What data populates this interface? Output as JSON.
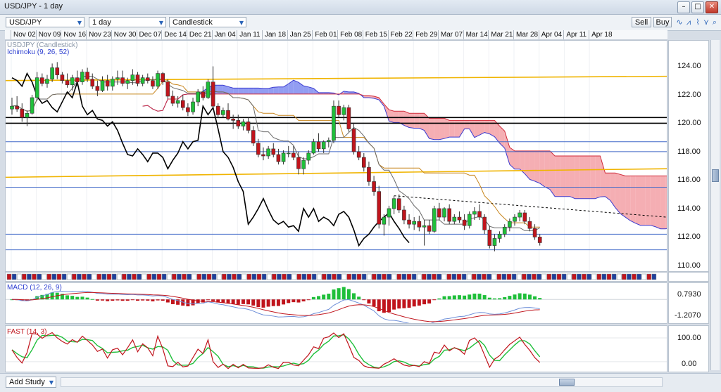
{
  "window": {
    "title": "USD/JPY - 1 day",
    "minimize_glyph": "–",
    "maximize_glyph": "□",
    "close_glyph": "✕"
  },
  "toolbar": {
    "instrument": "USD/JPY",
    "interval": "1 day",
    "chart_type": "Candlestick",
    "sell_label": "Sell",
    "buy_label": "Buy",
    "icons": [
      "line-draw-icon",
      "trend-icon",
      "crosshair-icon",
      "indicator-icon",
      "zoom-icon",
      "more-icon"
    ]
  },
  "date_labels": [
    "Nov 02",
    "Nov 09",
    "Nov 16",
    "Nov 23",
    "Nov 30",
    "Dec 07",
    "Dec 14",
    "Dec 21",
    "Jan 04",
    "Jan 11",
    "Jan 18",
    "Jan 25",
    "Feb 01",
    "Feb 08",
    "Feb 15",
    "Feb 22",
    "Feb 29",
    "Mar 07",
    "Mar 14",
    "Mar 21",
    "Mar 28",
    "Apr 04",
    "Apr 11",
    "Apr 18"
  ],
  "main_panel": {
    "label_symbol": "USDJPY (Candlestick)",
    "label_ichimoku": "Ichimoku (9, 26, 52)",
    "axis_ticks": [
      "124.00",
      "122.00",
      "120.00",
      "118.00",
      "116.00",
      "114.00",
      "112.00",
      "110.00"
    ]
  },
  "macd_panel": {
    "label": "MACD (12, 26, 9)",
    "axis_ticks": [
      "0.7930",
      "-1.2070"
    ]
  },
  "fast_panel": {
    "label": "FAST (14, 3)",
    "axis_ticks": [
      "100.00",
      "0.00"
    ]
  },
  "bottom": {
    "add_study": "Add Study"
  },
  "colors": {
    "bull": "#1fbf3a",
    "bear": "#c0141c",
    "cloud_blue": "#7f8cf0",
    "cloud_red": "#f3a0a6",
    "kijun": "#c8861e",
    "tenkan": "#6a6a6a",
    "chikou": "#000000",
    "hline_blue": "#4169c8",
    "hline_black": "#000000",
    "hline_orange": "#f0b400"
  },
  "chart_data": [
    {
      "type": "candlestick",
      "title": "USDJPY (Candlestick)",
      "ylim": [
        109.6,
        125.8
      ],
      "x_start": "Nov 02",
      "candles": [
        [
          121.0,
          121.8,
          120.6,
          121.2
        ],
        [
          121.2,
          121.9,
          120.8,
          121.0
        ],
        [
          121.0,
          121.4,
          120.1,
          120.4
        ],
        [
          120.4,
          120.9,
          119.8,
          120.7
        ],
        [
          120.7,
          122.0,
          120.6,
          121.8
        ],
        [
          121.8,
          123.6,
          121.6,
          123.2
        ],
        [
          123.2,
          123.5,
          122.6,
          122.8
        ],
        [
          122.8,
          123.4,
          122.5,
          123.1
        ],
        [
          123.1,
          124.2,
          122.9,
          123.9
        ],
        [
          123.9,
          124.3,
          123.1,
          123.4
        ],
        [
          123.4,
          123.6,
          122.8,
          123.0
        ],
        [
          123.0,
          123.5,
          122.5,
          122.7
        ],
        [
          122.7,
          123.4,
          122.3,
          123.2
        ],
        [
          123.2,
          123.7,
          122.6,
          122.9
        ],
        [
          122.9,
          123.8,
          122.7,
          123.6
        ],
        [
          123.6,
          123.9,
          122.9,
          123.1
        ],
        [
          123.1,
          123.5,
          122.4,
          122.6
        ],
        [
          122.6,
          123.0,
          121.9,
          122.3
        ],
        [
          122.3,
          123.3,
          122.2,
          123.0
        ],
        [
          123.0,
          123.4,
          122.3,
          122.6
        ],
        [
          122.6,
          123.3,
          122.3,
          123.1
        ],
        [
          123.1,
          123.7,
          122.7,
          123.2
        ],
        [
          123.2,
          123.7,
          122.6,
          122.8
        ],
        [
          122.8,
          123.2,
          122.4,
          123.0
        ],
        [
          123.0,
          123.8,
          122.7,
          123.4
        ],
        [
          123.4,
          123.6,
          122.6,
          122.8
        ],
        [
          122.8,
          123.4,
          122.6,
          123.2
        ],
        [
          123.2,
          123.5,
          122.8,
          123.0
        ],
        [
          123.0,
          123.3,
          122.4,
          122.6
        ],
        [
          122.6,
          123.7,
          122.4,
          123.5
        ],
        [
          123.5,
          123.6,
          122.7,
          122.9
        ],
        [
          122.9,
          123.1,
          121.7,
          121.9
        ],
        [
          121.9,
          122.3,
          121.2,
          121.4
        ],
        [
          121.4,
          121.9,
          121.1,
          121.6
        ],
        [
          121.6,
          122.0,
          120.9,
          121.1
        ],
        [
          121.1,
          121.4,
          120.5,
          120.8
        ],
        [
          120.8,
          121.8,
          120.6,
          121.5
        ],
        [
          121.5,
          122.4,
          121.2,
          122.2
        ],
        [
          122.2,
          122.6,
          121.6,
          121.8
        ],
        [
          121.8,
          123.1,
          121.7,
          122.9
        ],
        [
          122.9,
          124.0,
          121.1,
          121.2
        ],
        [
          121.2,
          121.4,
          120.4,
          120.6
        ],
        [
          120.6,
          121.1,
          120.4,
          120.9
        ],
        [
          120.9,
          121.4,
          120.2,
          120.3
        ],
        [
          120.3,
          120.6,
          119.6,
          120.2
        ],
        [
          120.2,
          120.6,
          119.6,
          119.8
        ],
        [
          119.8,
          120.3,
          119.5,
          120.1
        ],
        [
          120.1,
          120.4,
          119.3,
          119.5
        ],
        [
          119.5,
          119.8,
          118.4,
          118.6
        ],
        [
          118.6,
          118.9,
          117.6,
          117.8
        ],
        [
          117.8,
          118.3,
          117.4,
          117.7
        ],
        [
          117.7,
          118.4,
          117.5,
          118.2
        ],
        [
          118.2,
          118.6,
          117.6,
          117.8
        ],
        [
          117.8,
          118.2,
          117.1,
          117.3
        ],
        [
          117.3,
          118.1,
          117.1,
          117.9
        ],
        [
          117.9,
          118.4,
          117.6,
          117.9
        ],
        [
          117.9,
          118.4,
          117.4,
          117.6
        ],
        [
          117.6,
          118.0,
          116.4,
          116.8
        ],
        [
          116.8,
          117.6,
          116.4,
          117.4
        ],
        [
          117.4,
          118.1,
          117.1,
          117.9
        ],
        [
          117.9,
          118.9,
          117.8,
          118.7
        ],
        [
          118.7,
          119.3,
          118.0,
          118.2
        ],
        [
          118.2,
          118.8,
          117.9,
          118.7
        ],
        [
          118.7,
          119.0,
          118.3,
          118.8
        ],
        [
          118.8,
          121.6,
          118.6,
          121.2
        ],
        [
          121.2,
          121.6,
          120.4,
          120.6
        ],
        [
          120.6,
          121.3,
          120.2,
          121.1
        ],
        [
          121.1,
          121.3,
          119.4,
          119.6
        ],
        [
          119.6,
          120.0,
          117.8,
          118.0
        ],
        [
          118.0,
          118.4,
          117.4,
          117.6
        ],
        [
          117.6,
          117.9,
          116.6,
          116.9
        ],
        [
          116.9,
          117.3,
          115.6,
          115.9
        ],
        [
          115.9,
          116.3,
          114.9,
          115.2
        ],
        [
          115.2,
          115.6,
          112.6,
          112.9
        ],
        [
          112.9,
          113.6,
          112.1,
          113.4
        ],
        [
          113.4,
          114.2,
          112.8,
          114.0
        ],
        [
          114.0,
          114.9,
          113.6,
          114.7
        ],
        [
          114.7,
          115.0,
          113.7,
          113.9
        ],
        [
          113.9,
          114.2,
          112.9,
          113.2
        ],
        [
          113.2,
          113.6,
          112.6,
          112.9
        ],
        [
          112.9,
          113.4,
          112.5,
          113.1
        ],
        [
          113.1,
          113.5,
          112.4,
          112.7
        ],
        [
          112.7,
          113.2,
          111.4,
          112.8
        ],
        [
          112.8,
          113.2,
          112.2,
          112.4
        ],
        [
          112.4,
          114.2,
          112.3,
          114.0
        ],
        [
          114.0,
          114.4,
          113.2,
          113.4
        ],
        [
          113.4,
          114.1,
          113.1,
          114.0
        ],
        [
          114.0,
          114.3,
          112.9,
          113.1
        ],
        [
          113.1,
          113.6,
          112.9,
          113.4
        ],
        [
          113.4,
          113.8,
          113.0,
          113.2
        ],
        [
          113.2,
          113.6,
          112.5,
          112.8
        ],
        [
          112.8,
          113.8,
          112.6,
          113.6
        ],
        [
          113.6,
          114.1,
          113.2,
          113.8
        ],
        [
          113.8,
          114.3,
          113.2,
          113.4
        ],
        [
          113.4,
          113.6,
          112.2,
          112.5
        ],
        [
          112.5,
          112.8,
          111.2,
          111.4
        ],
        [
          111.4,
          112.2,
          111.0,
          111.9
        ],
        [
          111.9,
          112.4,
          111.6,
          112.2
        ],
        [
          112.2,
          112.9,
          112.0,
          112.7
        ],
        [
          112.7,
          113.3,
          112.4,
          113.1
        ],
        [
          113.1,
          113.6,
          112.8,
          113.4
        ],
        [
          113.4,
          113.9,
          113.1,
          113.7
        ],
        [
          113.7,
          113.9,
          112.9,
          113.1
        ],
        [
          113.1,
          113.4,
          112.4,
          112.6
        ],
        [
          112.6,
          112.9,
          111.8,
          112.0
        ],
        [
          112.0,
          112.2,
          111.4,
          111.6
        ]
      ],
      "horizontal_lines": {
        "blue": [
          118.7,
          118.0,
          115.5,
          112.2,
          111.1
        ],
        "black": [
          120.4,
          120.0
        ],
        "orange_trend": [
          [
            123.0,
            123.3
          ],
          [
            116.2,
            116.8
          ]
        ],
        "dashed_trend": [
          114.9,
          113.4
        ]
      }
    },
    {
      "type": "line",
      "title": "MACD (12, 26, 9)",
      "ylim": [
        -1.6,
        1.1
      ]
    },
    {
      "type": "line",
      "title": "FAST (14, 3)",
      "ylim": [
        -5,
        110
      ]
    }
  ]
}
